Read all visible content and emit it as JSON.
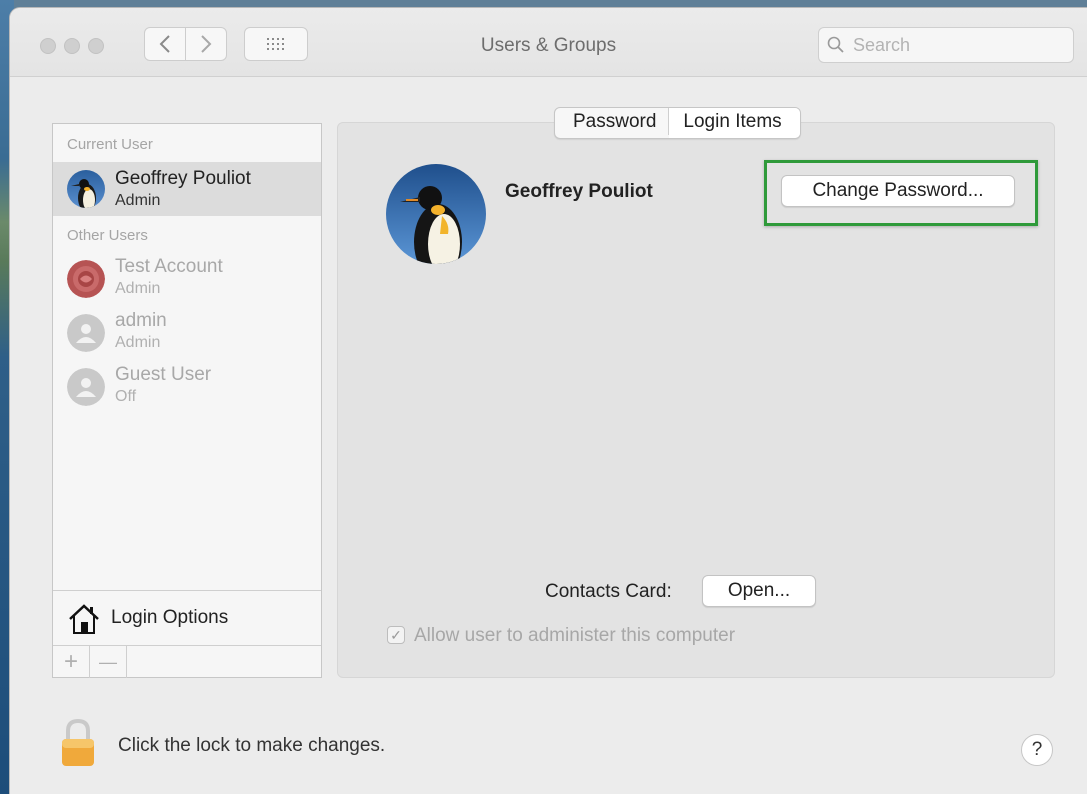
{
  "window": {
    "title": "Users & Groups"
  },
  "toolbar": {
    "back_icon": "chevron-left",
    "forward_icon": "chevron-right",
    "grid_icon": "grid-icon",
    "search_placeholder": "Search"
  },
  "sidebar": {
    "current_user_label": "Current User",
    "other_users_label": "Other Users",
    "users": [
      {
        "name": "Geoffrey Pouliot",
        "role": "Admin",
        "selected": true,
        "avatar": "penguin"
      },
      {
        "name": "Test Account",
        "role": "Admin",
        "selected": false,
        "avatar": "rose"
      },
      {
        "name": "admin",
        "role": "Admin",
        "selected": false,
        "avatar": "generic"
      },
      {
        "name": "Guest User",
        "role": "Off",
        "selected": false,
        "avatar": "generic"
      }
    ],
    "login_options_label": "Login Options",
    "add_label": "+",
    "remove_label": "—"
  },
  "tabs": [
    {
      "label": "Password",
      "active": false
    },
    {
      "label": "Login Items",
      "active": true
    }
  ],
  "detail": {
    "user_name": "Geoffrey Pouliot",
    "change_password_label": "Change Password...",
    "contacts_card_label": "Contacts Card:",
    "open_label": "Open...",
    "allow_admin_label": "Allow user to administer this computer",
    "allow_admin_checked": true
  },
  "footer": {
    "lock_text": "Click the lock to make changes.",
    "help_label": "?"
  },
  "colors": {
    "highlight": "#2f9a3a",
    "selected_row": "#dcdcdc",
    "lock": "#f0a93b"
  }
}
